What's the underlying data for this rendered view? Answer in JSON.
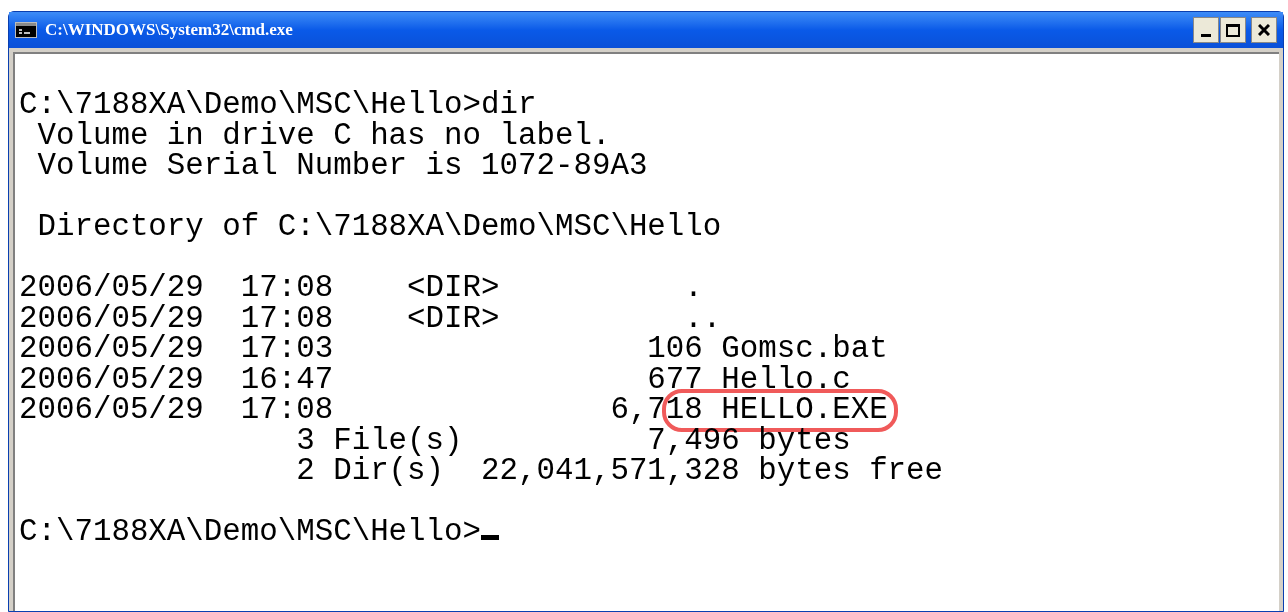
{
  "window": {
    "title": "C:\\WINDOWS\\System32\\cmd.exe"
  },
  "console": {
    "blocks": [
      [
        {
          "text": "C:\\7188XA\\Demo\\MSC\\Hello>dir",
          "highlighted": false
        },
        {
          "text": " Volume in drive C has no label.",
          "highlighted": false
        },
        {
          "text": " Volume Serial Number is 1072-89A3",
          "highlighted": false
        }
      ],
      [
        {
          "text": " Directory of C:\\7188XA\\Demo\\MSC\\Hello",
          "highlighted": false
        }
      ],
      [
        {
          "text": "2006/05/29  17:08    <DIR>          .",
          "highlighted": false
        },
        {
          "text": "2006/05/29  17:08    <DIR>          ..",
          "highlighted": false
        },
        {
          "text": "2006/05/29  17:03                 106 Gomsc.bat",
          "highlighted": false
        },
        {
          "text": "2006/05/29  16:47                 677 Hello.c",
          "highlighted": false
        },
        {
          "text": "2006/05/29  17:08               6,718 HELLO.EXE",
          "highlighted": true
        },
        {
          "text": "               3 File(s)          7,496 bytes",
          "highlighted": false
        },
        {
          "text": "               2 Dir(s)  22,041,571,328 bytes free",
          "highlighted": false
        }
      ],
      [
        {
          "text": "C:\\7188XA\\Demo\\MSC\\Hello>",
          "highlighted": false
        }
      ]
    ],
    "cursor_visible": true
  }
}
